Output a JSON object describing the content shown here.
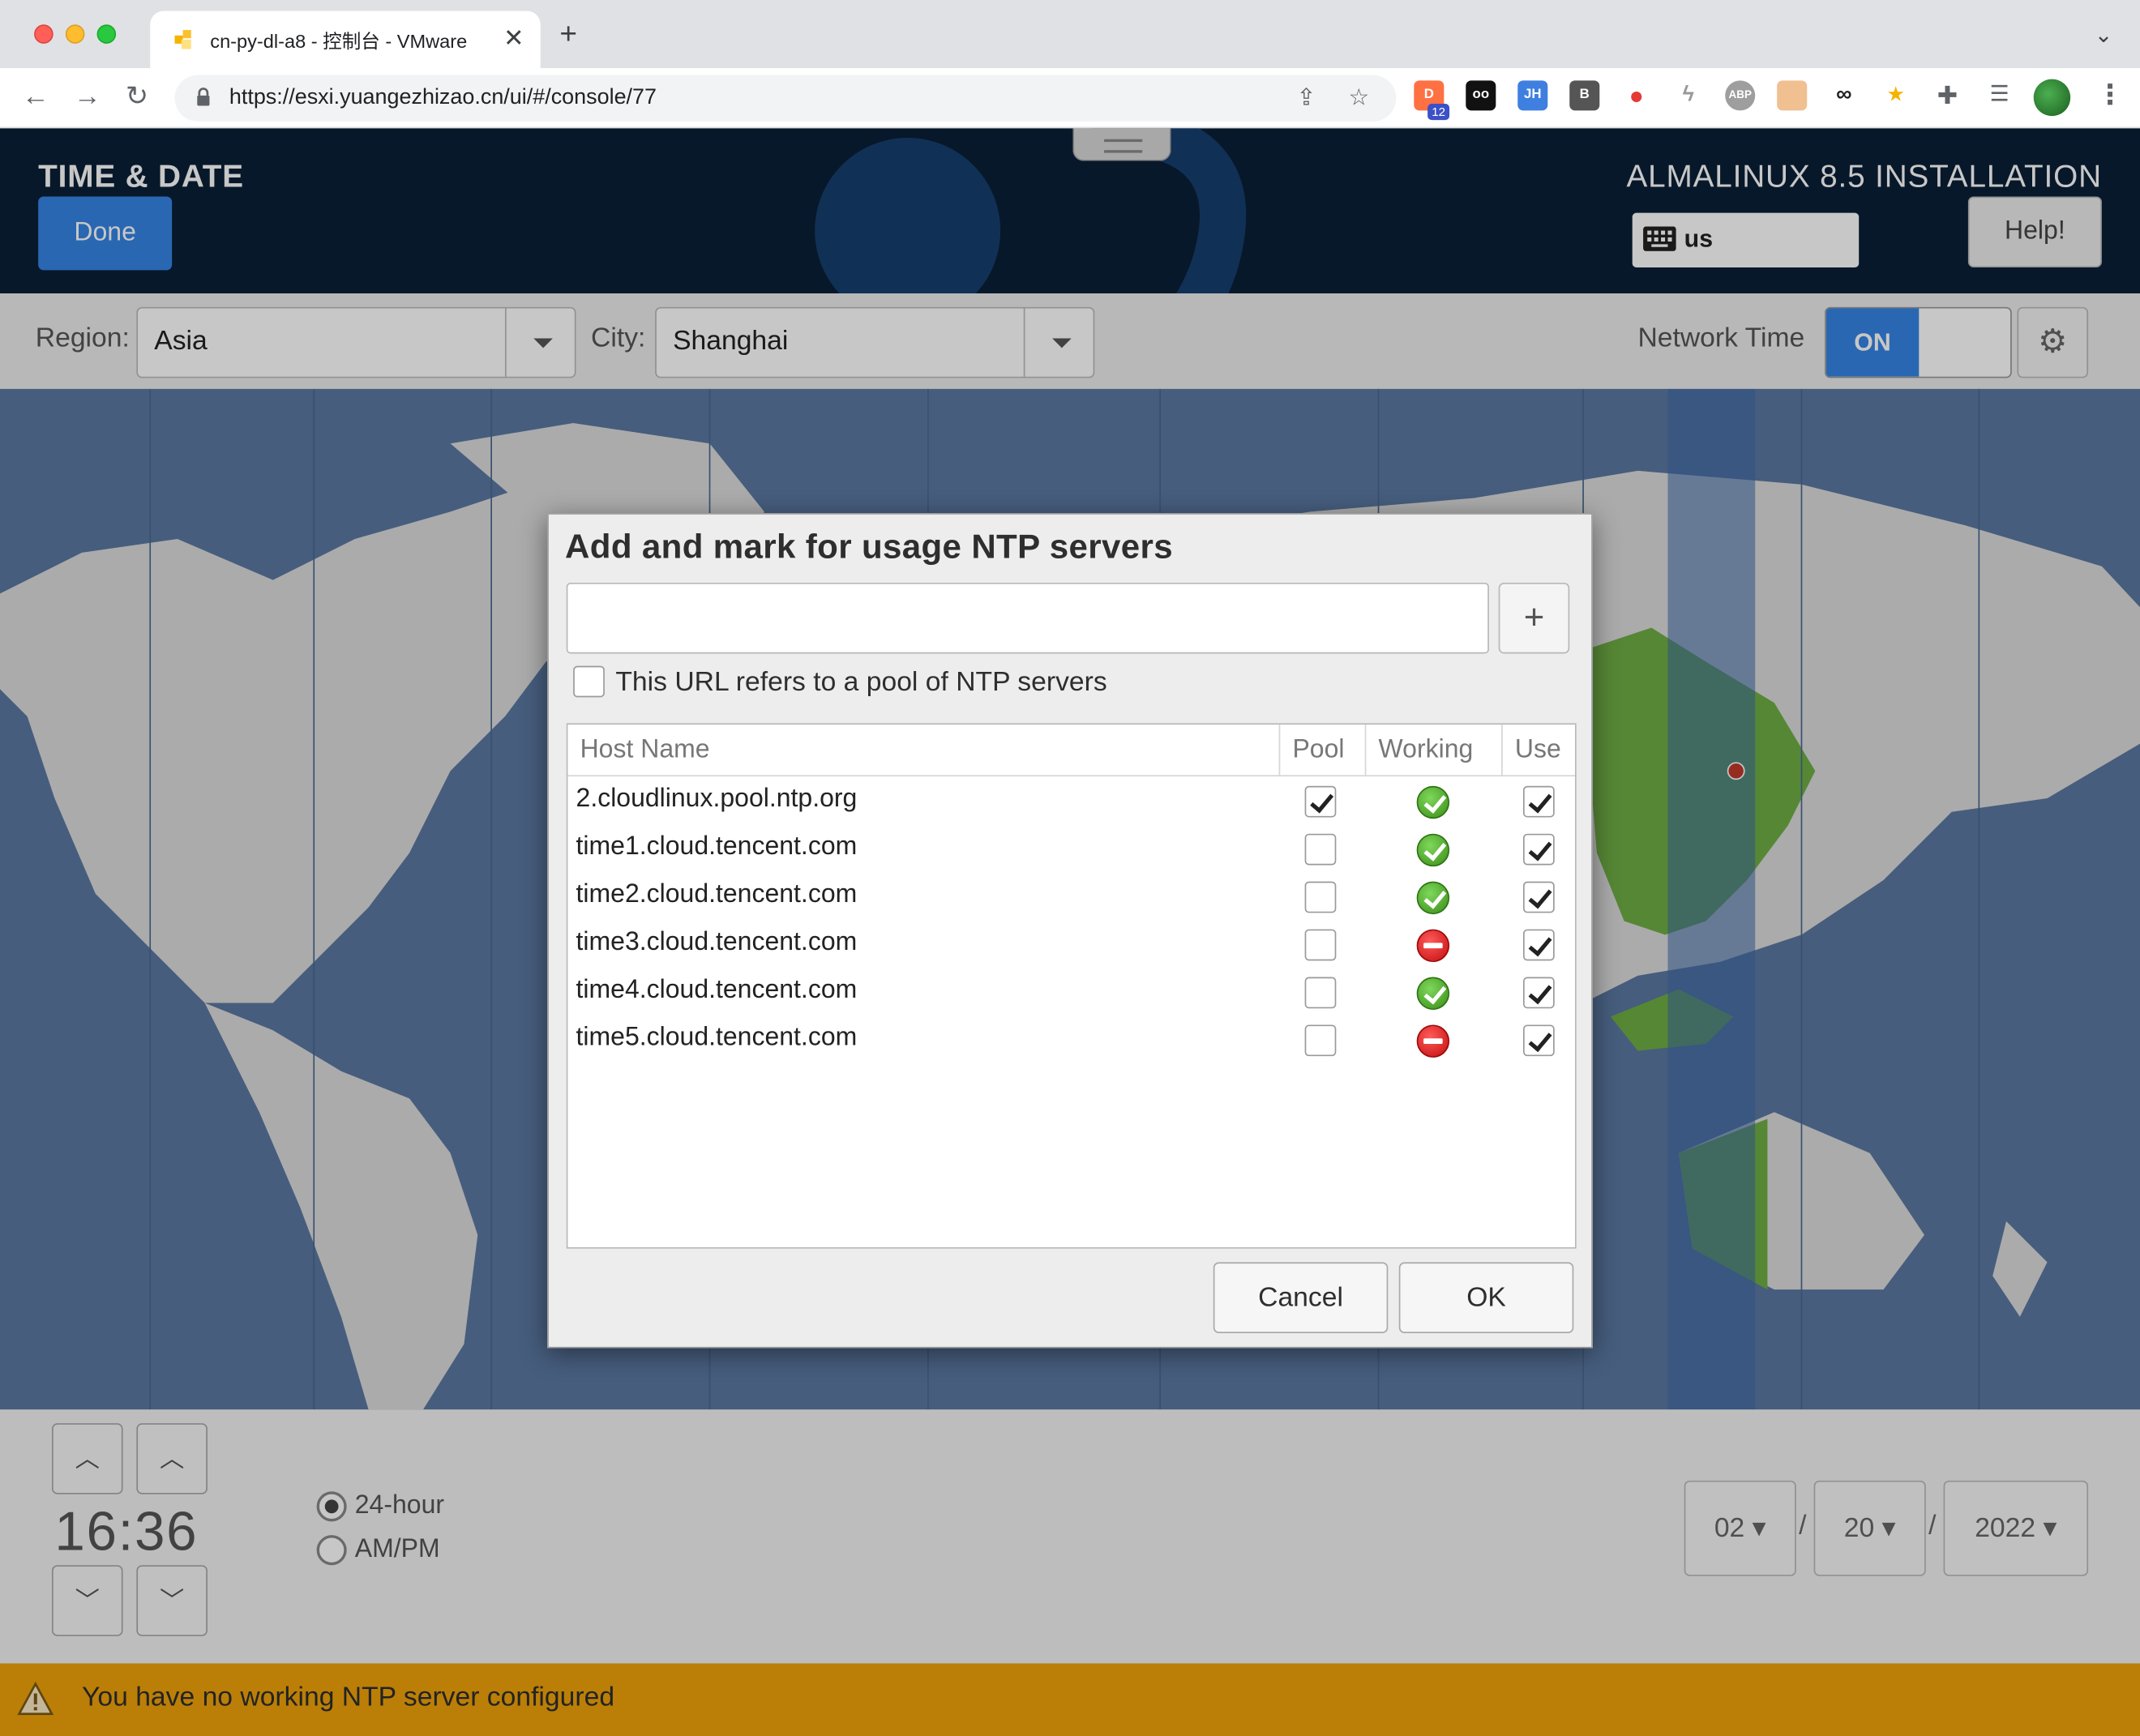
{
  "browser": {
    "tab_title": "cn-py-dl-a8 - 控制台 - VMware",
    "url": "https://esxi.yuangezhizao.cn/ui/#/console/77",
    "extension_badge": "12"
  },
  "installer": {
    "spoke_title": "TIME & DATE",
    "done_label": "Done",
    "product_title": "ALMALINUX 8.5 INSTALLATION",
    "keyboard_layout": "us",
    "help_label": "Help!",
    "region_label": "Region:",
    "region_value": "Asia",
    "city_label": "City:",
    "city_value": "Shanghai",
    "network_time_label": "Network Time",
    "network_time_state": "ON",
    "time": "16:36",
    "format_24h": "24-hour",
    "format_ampm": "AM/PM",
    "month": "02",
    "day": "20",
    "year": "2022",
    "date_sep": "/",
    "warning": "You have no working NTP server configured"
  },
  "dialog": {
    "title": "Add and mark for usage NTP servers",
    "add_symbol": "+",
    "pool_checkbox_label": "This URL refers to a pool of NTP servers",
    "columns": {
      "host": "Host Name",
      "pool": "Pool",
      "working": "Working",
      "use": "Use"
    },
    "servers": [
      {
        "host": "2.cloudlinux.pool.ntp.org",
        "pool": true,
        "working": true,
        "use": true
      },
      {
        "host": "time1.cloud.tencent.com",
        "pool": false,
        "working": true,
        "use": true
      },
      {
        "host": "time2.cloud.tencent.com",
        "pool": false,
        "working": true,
        "use": true
      },
      {
        "host": "time3.cloud.tencent.com",
        "pool": false,
        "working": false,
        "use": true
      },
      {
        "host": "time4.cloud.tencent.com",
        "pool": false,
        "working": true,
        "use": true
      },
      {
        "host": "time5.cloud.tencent.com",
        "pool": false,
        "working": false,
        "use": true
      }
    ],
    "cancel_label": "Cancel",
    "ok_label": "OK"
  },
  "colors": {
    "header_bg": "#0a1f36",
    "accent_blue": "#3584e4",
    "warning_bg": "#f0a30a",
    "map_ocean": "#5a78a0",
    "map_land": "#dcdcdc",
    "map_selected": "#6fae45"
  }
}
